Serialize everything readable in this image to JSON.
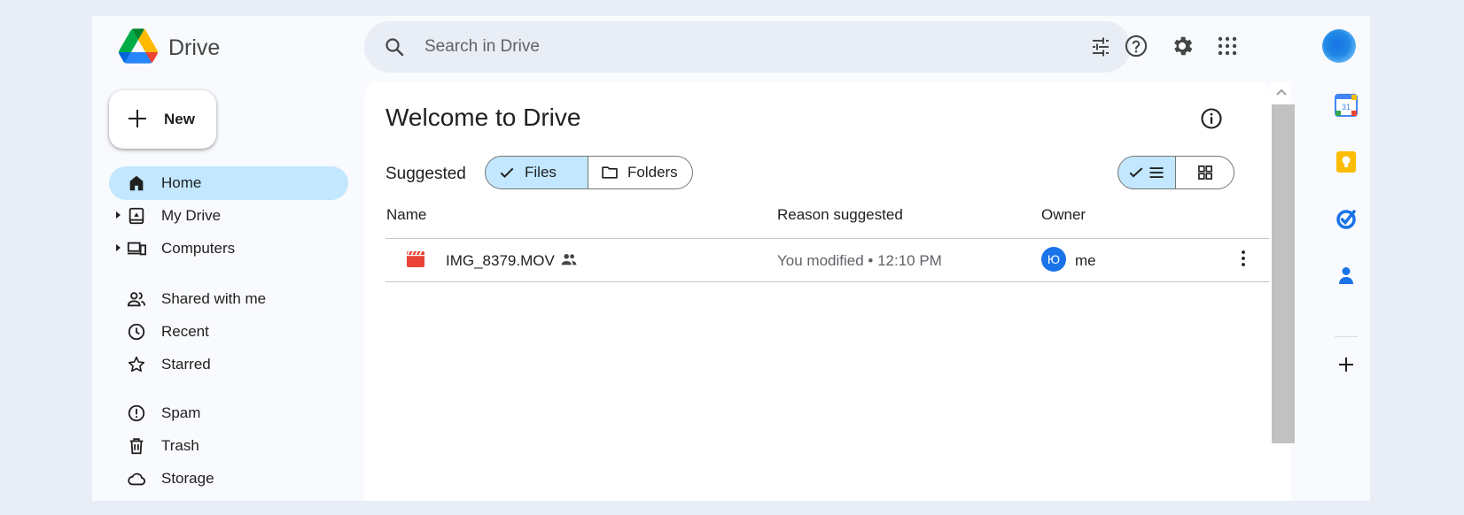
{
  "app": {
    "title": "Drive"
  },
  "search": {
    "placeholder": "Search in Drive"
  },
  "sidebar": {
    "new_label": "New",
    "items": [
      {
        "label": "Home"
      },
      {
        "label": "My Drive"
      },
      {
        "label": "Computers"
      },
      {
        "label": "Shared with me"
      },
      {
        "label": "Recent"
      },
      {
        "label": "Starred"
      },
      {
        "label": "Spam"
      },
      {
        "label": "Trash"
      },
      {
        "label": "Storage"
      }
    ]
  },
  "main": {
    "title": "Welcome to Drive",
    "suggested_label": "Suggested",
    "chips": {
      "files": "Files",
      "folders": "Folders"
    },
    "columns": {
      "name": "Name",
      "reason": "Reason suggested",
      "owner": "Owner"
    },
    "files": [
      {
        "name": "IMG_8379.MOV",
        "reason": "You modified • 12:10 PM",
        "owner_initial": "Ю",
        "owner": "me"
      }
    ]
  },
  "side_panel": {
    "calendar_day": "31"
  },
  "colors": {
    "accent": "#c2e7ff",
    "brand_blue": "#1a73e8",
    "video_red": "#ea4335"
  }
}
